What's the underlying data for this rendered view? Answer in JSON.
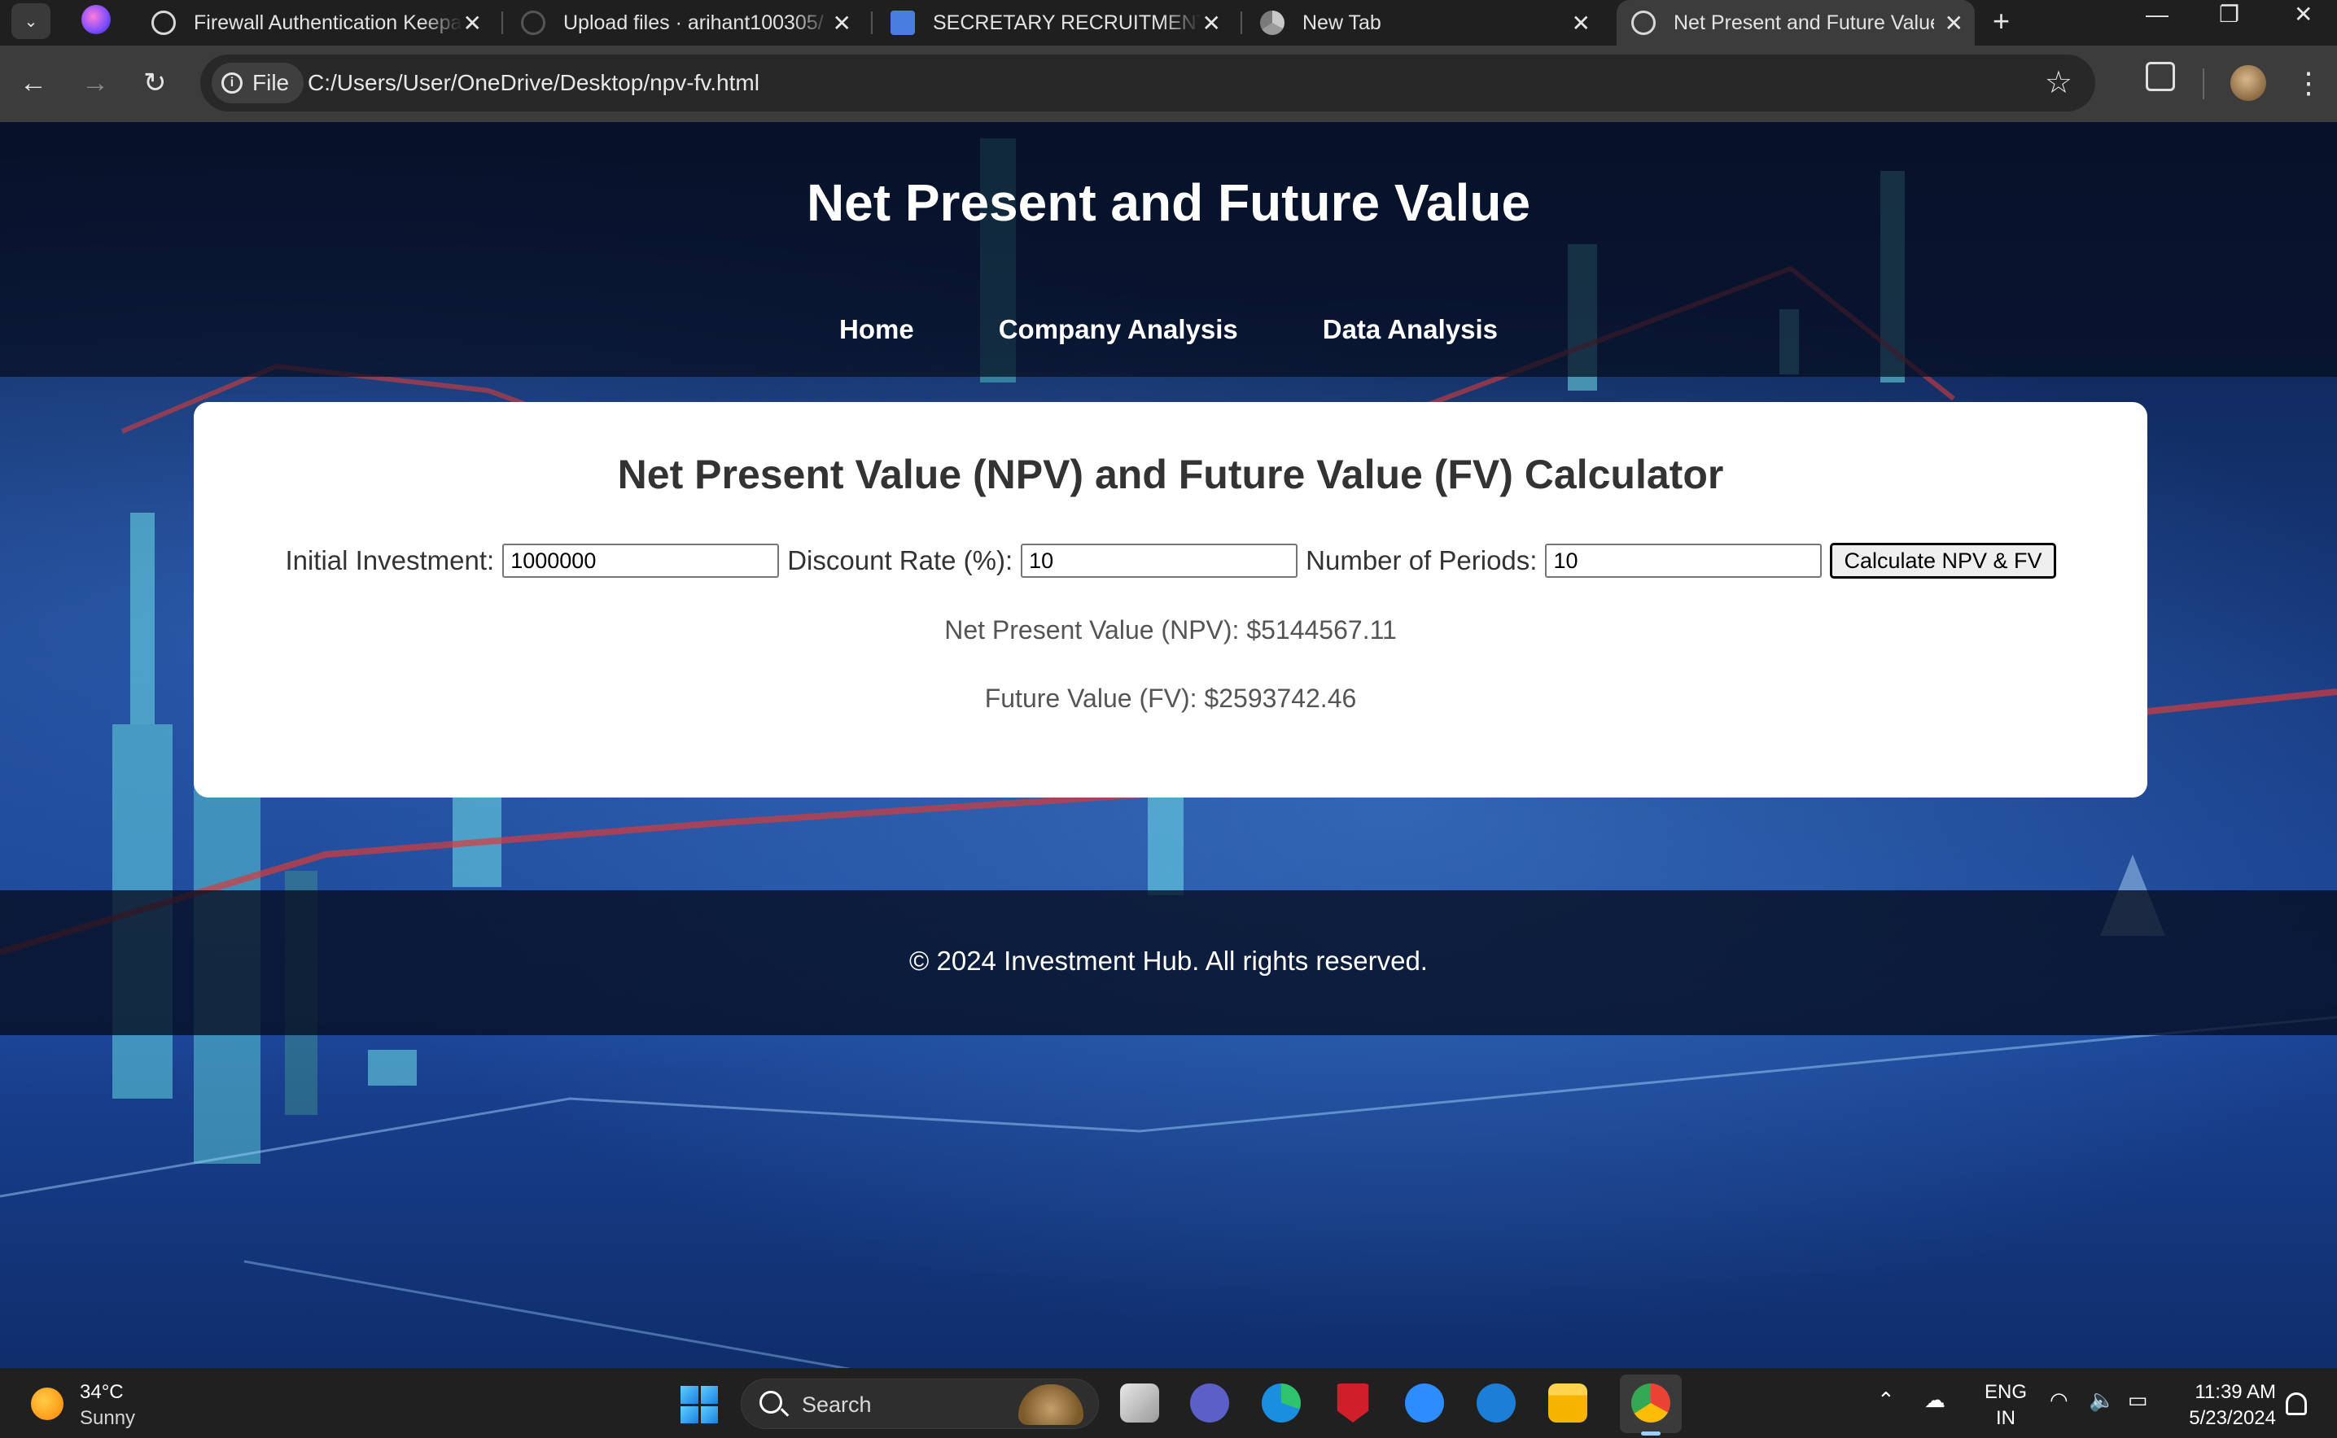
{
  "browser": {
    "tabs": [
      {
        "title": "Firewall Authentication Keepa",
        "favicon": "globe-icon"
      },
      {
        "title": "Upload files · arihant100305/",
        "favicon": "github-icon"
      },
      {
        "title": "SECRETARY RECRUITMENT TA",
        "favicon": "docs-icon"
      },
      {
        "title": "New Tab",
        "favicon": "chrome-icon"
      },
      {
        "title": "Net Present and Future Value",
        "favicon": "globe-icon",
        "active": true
      }
    ],
    "url_chip": "File",
    "url": "C:/Users/User/OneDrive/Desktop/npv-fv.html"
  },
  "site": {
    "title": "Net Present and Future Value",
    "nav": [
      "Home",
      "Company Analysis",
      "Data Analysis"
    ],
    "footer": "© 2024 Investment Hub. All rights reserved."
  },
  "calculator": {
    "heading": "Net Present Value (NPV) and Future Value (FV) Calculator",
    "initial_investment_label": "Initial Investment:",
    "initial_investment_value": "1000000",
    "discount_rate_label": "Discount Rate (%):",
    "discount_rate_value": "10",
    "periods_label": "Number of Periods:",
    "periods_value": "10",
    "button_label": "Calculate NPV & FV",
    "npv_result": "Net Present Value (NPV): $5144567.11",
    "fv_result": "Future Value (FV): $2593742.46"
  },
  "taskbar": {
    "temperature": "34°C",
    "condition": "Sunny",
    "search_placeholder": "Search",
    "lang_top": "ENG",
    "lang_bottom": "IN",
    "time": "11:39 AM",
    "date": "5/23/2024"
  },
  "colors": {
    "page_bg_dark": "#0c1f46",
    "page_bg_mid": "#1b4598",
    "card_bg": "#ffffff",
    "heading_text": "#333333",
    "result_text": "#555555"
  }
}
